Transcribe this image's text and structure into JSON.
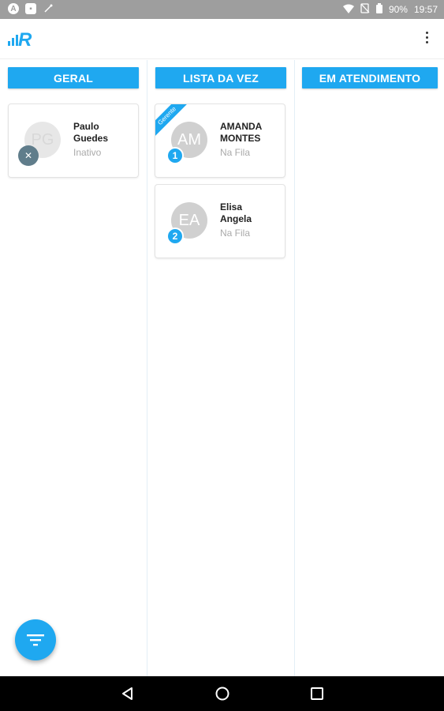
{
  "status_bar": {
    "battery": "90%",
    "time": "19:57",
    "icons": [
      "android-notification-icon",
      "app-notification-icon",
      "usb-icon",
      "wifi-icon",
      "no-sim-icon",
      "battery-icon"
    ]
  },
  "app_bar": {
    "logo_letter": "R",
    "menu_icon": "more-vertical-icon"
  },
  "columns": {
    "geral": {
      "title": "GERAL",
      "cards": [
        {
          "name_line1": "Paulo",
          "name_line2": "Guedes",
          "status": "Inativo",
          "initials": "PG",
          "action_icon": "close-icon",
          "action_symbol": "✕"
        }
      ]
    },
    "lista": {
      "title": "LISTA DA VEZ",
      "cards": [
        {
          "name_line1": "AMANDA",
          "name_line2": "MONTES",
          "status": "Na Fila",
          "initials": "AM",
          "position": "1",
          "ribbon": "Gerente"
        },
        {
          "name_line1": "Elisa",
          "name_line2": "Angela",
          "status": "Na Fila",
          "initials": "EA",
          "position": "2"
        }
      ]
    },
    "atendimento": {
      "title": "EM ATENDIMENTO",
      "cards": []
    }
  },
  "fab": {
    "icon": "filter-icon"
  },
  "nav": {
    "back_icon": "back-icon",
    "home_icon": "home-icon",
    "recents_icon": "recents-icon"
  },
  "colors": {
    "accent": "#1fa8f0",
    "status_bar": "#9e9e9e",
    "remove_button": "#607d8b"
  }
}
